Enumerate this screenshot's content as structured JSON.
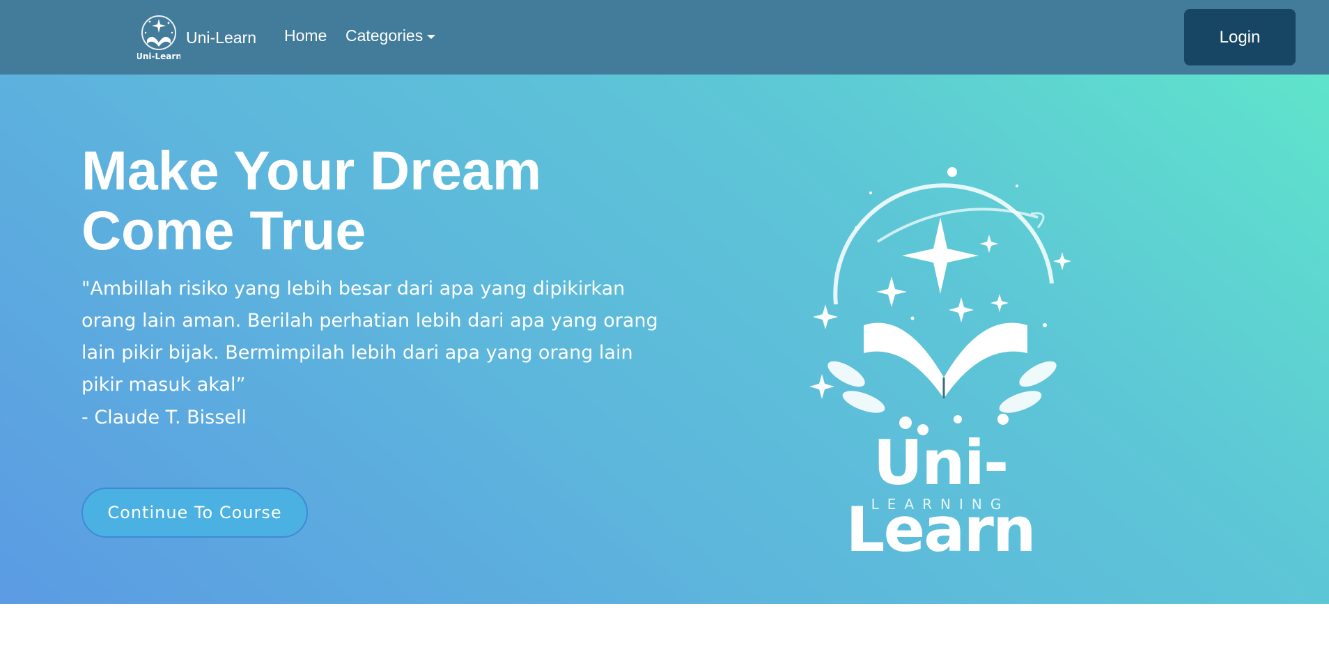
{
  "navbar": {
    "brand": "Uni-Learn",
    "brand_logo_wordmark": "Uni-Learn",
    "links": {
      "home": "Home",
      "categories": "Categories"
    },
    "login_label": "Login",
    "bg_color": "#437c9a",
    "login_color": "#164663"
  },
  "hero": {
    "title": "Make Your Dream Come True",
    "quote": "\"Ambillah risiko yang lebih besar dari apa yang dipikirkan orang lain aman. Berilah perhatian lebih dari apa yang orang lain pikir bijak. Bermimpilah lebih dari apa yang orang lain pikir masuk akal”",
    "author": "- Claude T. Bissell",
    "cta_label": "Continue To Course",
    "logo_wordmark": "Uni-Learn",
    "logo_subtitle": "LEARNING",
    "gradient_colors": [
      "#5b9be3",
      "#5db6dc",
      "#5fe4cb"
    ]
  }
}
